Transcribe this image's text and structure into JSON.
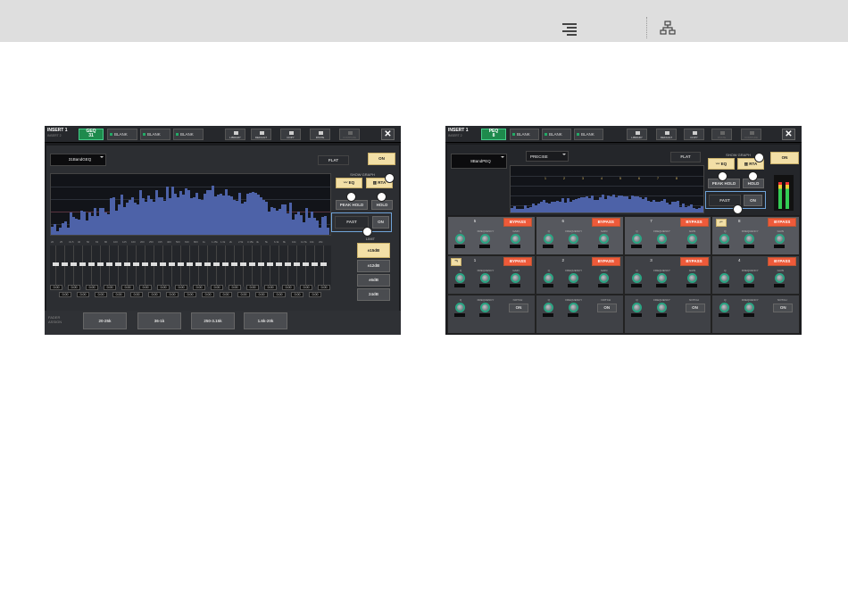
{
  "header": {
    "toc_icon": "list-icon",
    "sitemap_icon": "sitemap-icon"
  },
  "screens": [
    {
      "insert": {
        "title": "INSERT 1",
        "sub": "INSERT 2"
      },
      "tabs": [
        {
          "l1": "GEQ",
          "l2": "31",
          "active": true
        },
        {
          "label": "BLANK"
        },
        {
          "label": "BLANK"
        },
        {
          "label": "BLANK"
        }
      ],
      "toolbar": {
        "library": "LIBRARY",
        "default": "DEFAULT",
        "copy": "COPY",
        "paste": "PASTE",
        "compare": "COMPARE"
      },
      "close": "✕",
      "eq_name": "31BandGEQ",
      "flat": "FLAT",
      "on": "ON",
      "show_graph": "SHOW GRAPH",
      "eq_btn": "EQ",
      "rta_btn": "RTA",
      "peak_hold": "PEAK HOLD",
      "hold": "HOLD",
      "fast": "FAST",
      "fast_on": "ON",
      "range_label": "LIMIT",
      "ranges": [
        "±15dB",
        "±12dB",
        "±6dB",
        "24dB"
      ],
      "freqs": [
        "20",
        "25",
        "31.5",
        "40",
        "50",
        "63",
        "80",
        "100",
        "125",
        "160",
        "200",
        "250",
        "315",
        "400",
        "500",
        "630",
        "800",
        "1k",
        "1.25k",
        "1.6k",
        "2k",
        "2.5k",
        "3.15k",
        "4k",
        "5k",
        "6.3k",
        "8k",
        "10k",
        "12.5k",
        "16k",
        "20k"
      ],
      "gain_vals": [
        "0.00",
        "0.00",
        "0.00",
        "0.00",
        "0.00",
        "0.00",
        "0.00",
        "0.00",
        "0.00",
        "0.00",
        "0.00",
        "0.00",
        "0.00",
        "0.00",
        "0.00",
        "0.00",
        "0.00",
        "0.00",
        "0.00",
        "0.00",
        "0.00",
        "0.00",
        "0.00",
        "0.00",
        "0.00",
        "0.00",
        "0.00",
        "0.00",
        "0.00",
        "0.00",
        "0.00"
      ],
      "fader_assign": "FADER\nASSIGN",
      "assign": [
        "20-25k",
        "36-1k",
        "250-3.15k",
        "1.6k-20k"
      ]
    },
    {
      "insert": {
        "title": "INSERT 1",
        "sub": "INSERT 2"
      },
      "tabs": [
        {
          "l1": "PEQ",
          "l2": "8",
          "active": true
        },
        {
          "label": "BLANK"
        },
        {
          "label": "BLANK"
        },
        {
          "label": "BLANK"
        }
      ],
      "toolbar": {
        "library": "LIBRARY",
        "default": "DEFAULT",
        "copy": "COPY",
        "paste": "PASTE",
        "compare": "COMPARE"
      },
      "close": "✕",
      "eq_name": "8BandPEQ",
      "mode": "PRECISE",
      "flat": "FLAT",
      "on": "ON",
      "show_graph": "SHOW GRAPH",
      "eq_btn": "EQ",
      "rta_btn": "RTA",
      "peak_hold": "PEAK HOLD",
      "hold": "HOLD",
      "fast": "FAST",
      "fast_on": "ON",
      "band_labels": [
        "1",
        "2",
        "3",
        "4",
        "5",
        "6",
        "7",
        "8"
      ],
      "bands_upper": [
        "5",
        "6",
        "7",
        "8"
      ],
      "bands_lower": [
        "1",
        "2",
        "3",
        "4"
      ],
      "bypass": "BYPASS",
      "knob_labels": {
        "q": "Q",
        "freq": "FREQUENCY",
        "gain": "GAIN"
      },
      "notch": "NOTCH",
      "notch_on": "ON"
    }
  ]
}
